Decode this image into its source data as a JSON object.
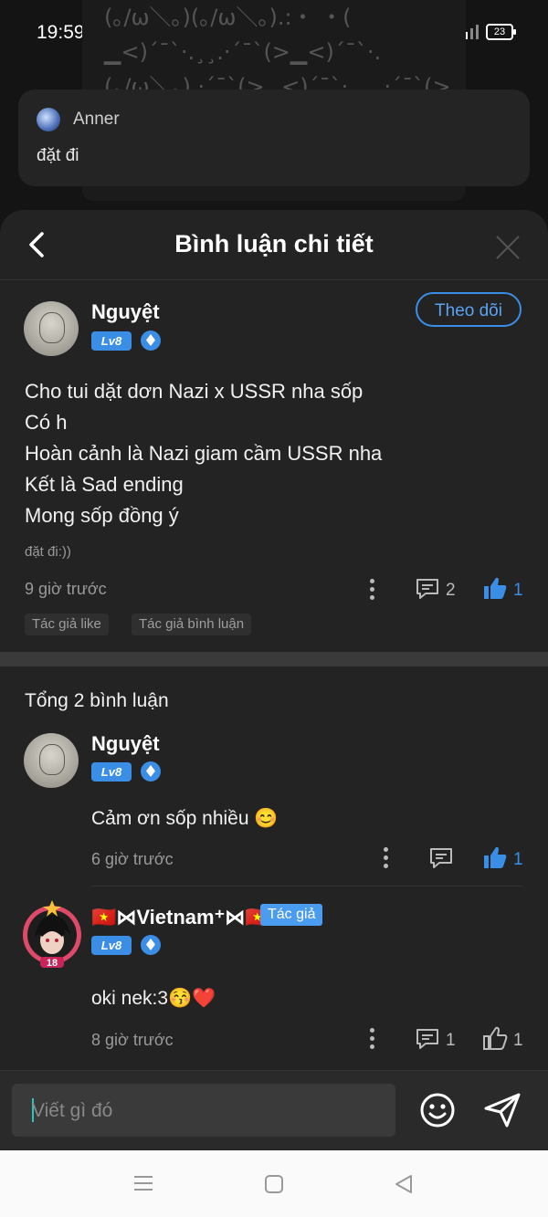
{
  "status": {
    "time": "19:59",
    "battery": "23"
  },
  "background": {
    "art_lines": [
      "(｡/ω＼｡)(｡/ω＼｡).:・ ・(",
      "▁<)´¯`·.¸¸.·´¯`(>▁<)´¯`·.",
      "(｡/ω＼｡).·´¯`(>▁<)´¯`·.¸¸.·´¯`(>▁<)"
    ]
  },
  "parent_comment": {
    "author": "Anner",
    "text": "đặt đi"
  },
  "sheet": {
    "title": "Bình luận chi tiết"
  },
  "post": {
    "author": "Nguyệt",
    "level": "Lv8",
    "follow_label": "Theo dõi",
    "lines": [
      "Cho tui dặt dơn Nazi x USSR nha sốp",
      "Có h",
      "Hoàn cảnh là Nazi giam cầm USSR nha",
      "Kết là Sad ending",
      "Mong sốp đồng ý"
    ],
    "note": "đặt đi:))",
    "time": "9 giờ trước",
    "comment_count": "2",
    "like_count": "1",
    "tags": [
      "Tác giả like",
      "Tác giả bình luận"
    ]
  },
  "total_label": "Tổng 2 bình luận",
  "replies": [
    {
      "author": "Nguyệt",
      "level": "Lv8",
      "text": "Cảm ơn sốp nhiều 😊",
      "time": "6 giờ trước",
      "like_count": "1"
    },
    {
      "author": "🇻🇳⋈Vietnam⁺⋈🇻🇳",
      "level": "Lv8",
      "author_tag": "Tác giả",
      "text": "oki nek:3😚❤️",
      "time": "8 giờ trước",
      "comment_count": "1",
      "like_count": "1"
    }
  ],
  "input": {
    "placeholder": "Viết gì đó"
  },
  "colors": {
    "accent": "#3a8ee6",
    "sheet_bg": "#232323",
    "background": "#141414"
  }
}
